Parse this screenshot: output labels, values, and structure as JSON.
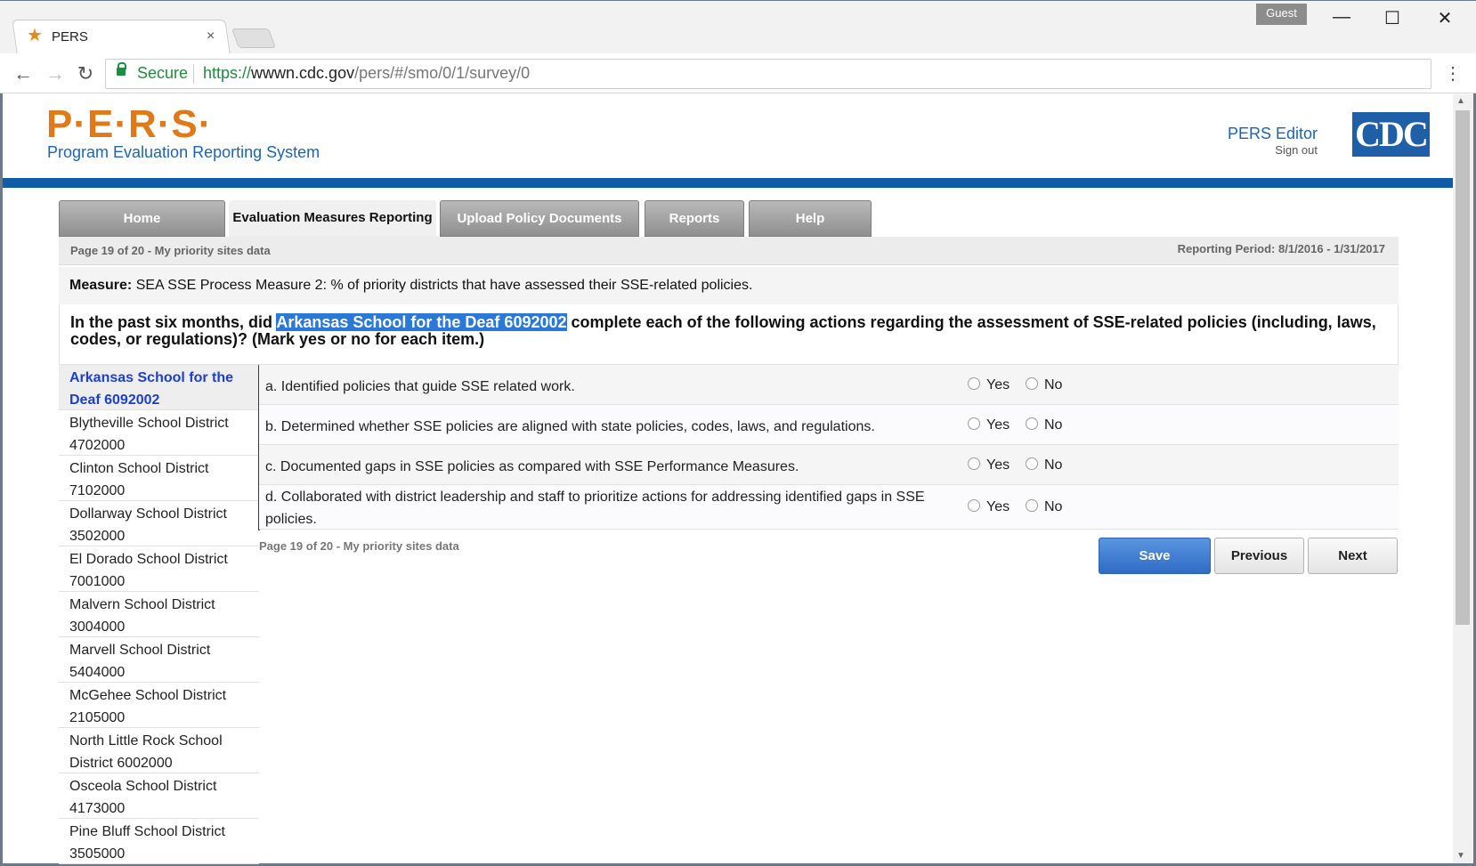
{
  "browser": {
    "tab_title": "PERS",
    "tab_close": "×",
    "profile": "Guest",
    "minimize": "—",
    "maximize": "☐",
    "close": "✕",
    "back": "←",
    "forward": "→",
    "reload": "↻",
    "secure_label": "Secure",
    "url_scheme": "https://",
    "url_host": "wwwn.cdc.gov",
    "url_path": "/pers/#/smo/0/1/survey/0",
    "menu": "⋮",
    "icons": {
      "tab": "star-icon",
      "lock": "lock-icon"
    }
  },
  "header": {
    "logo": "P·E·R·S·",
    "subtitle": "Program Evaluation Reporting System",
    "user_role": "PERS Editor",
    "signout": "Sign out",
    "cdc_logo": "CDC",
    "colors": {
      "brand_orange": "#e07a18",
      "brand_blue": "#1a66b5",
      "bar_blue": "#0f5ba7"
    }
  },
  "nav": {
    "tabs": [
      {
        "label": "Home",
        "active": false
      },
      {
        "label": "Evaluation Measures Reporting",
        "active": true
      },
      {
        "label": "Upload Policy Documents",
        "active": false
      },
      {
        "label": "Reports",
        "active": false
      },
      {
        "label": "Help",
        "active": false
      }
    ]
  },
  "content": {
    "page_indicator": "Page 19 of 20 - My priority sites data",
    "reporting_period": "Reporting Period: 8/1/2016 - 1/31/2017",
    "measure_label": "Measure:",
    "measure_text": "SEA SSE Process Measure 2: % of priority districts that have assessed their SSE-related policies.",
    "question_before": "In the past six months, did ",
    "question_site": "Arkansas School for the Deaf 6092002",
    "question_after": " complete each of the following actions regarding the assessment of SSE-related policies (including, laws, codes, or regulations)? (Mark yes or no for each item.)",
    "sites": [
      "Arkansas School for the Deaf 6092002",
      "Blytheville School District 4702000",
      "Clinton School District 7102000",
      "Dollarway School District 3502000",
      "El Dorado School District 7001000",
      "Malvern School District 3004000",
      "Marvell School District 5404000",
      "McGehee School District 2105000",
      "North Little Rock School District 6002000",
      "Osceola School District 4173000",
      "Pine Bluff School District 3505000"
    ],
    "items": [
      {
        "text": "a. Identified policies that guide SSE related work.",
        "yes": "Yes",
        "no": "No"
      },
      {
        "text": "b. Determined whether SSE policies are aligned with state policies, codes, laws, and regulations.",
        "yes": "Yes",
        "no": "No"
      },
      {
        "text": "c. Documented gaps in SSE policies as compared with SSE Performance Measures.",
        "yes": "Yes",
        "no": "No"
      },
      {
        "text": "d. Collaborated with district leadership and staff to prioritize actions for addressing identified gaps in SSE policies.",
        "yes": "Yes",
        "no": "No"
      }
    ],
    "bottom_page_indicator": "Page 19 of 20 - My priority sites data",
    "buttons": {
      "save": "Save",
      "previous": "Previous",
      "next": "Next"
    }
  }
}
